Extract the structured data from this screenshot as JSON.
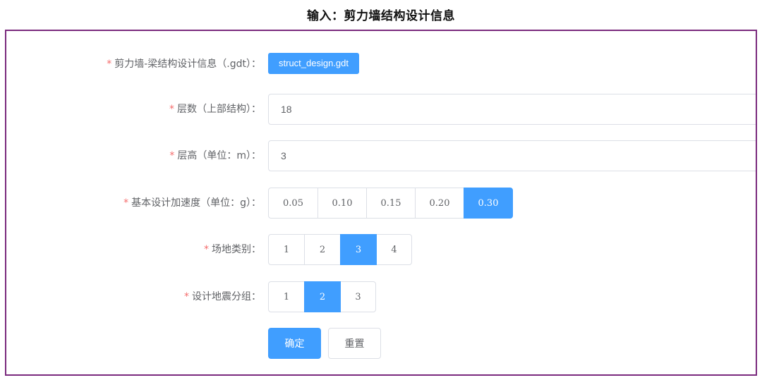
{
  "page": {
    "title": "输入：剪力墙结构设计信息"
  },
  "form": {
    "required_mark": "*",
    "design_file": {
      "label": "剪力墙-梁结构设计信息（.gdt）：",
      "button": "struct_design.gdt"
    },
    "floors": {
      "label": "层数（上部结构）：",
      "value": "18"
    },
    "floor_height": {
      "label": "层高（单位：m）：",
      "value": "3"
    },
    "acceleration": {
      "label": "基本设计加速度（单位：g）：",
      "options": [
        "0.05",
        "0.10",
        "0.15",
        "0.20",
        "0.30"
      ],
      "selected": "0.30"
    },
    "site_class": {
      "label": "场地类别：",
      "options": [
        "1",
        "2",
        "3",
        "4"
      ],
      "selected": "3"
    },
    "seismic_group": {
      "label": "设计地震分组：",
      "options": [
        "1",
        "2",
        "3"
      ],
      "selected": "2"
    },
    "confirm_button": "确定",
    "reset_button": "重置"
  },
  "colors": {
    "primary": "#409eff",
    "required": "#f56c6c",
    "frame": "#7a2a7d"
  }
}
